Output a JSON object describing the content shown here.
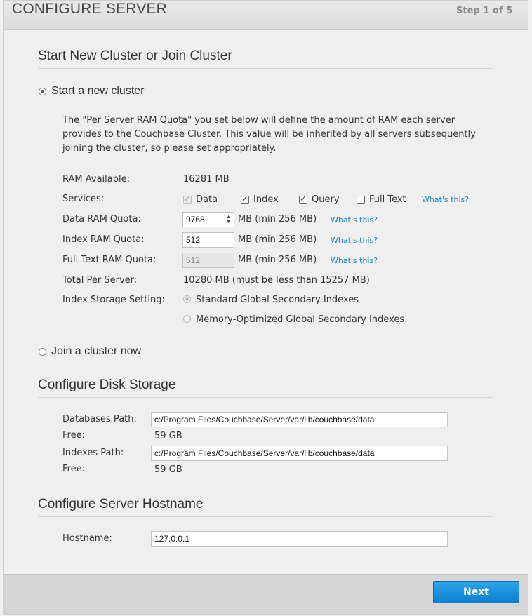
{
  "header": {
    "title": "CONFIGURE SERVER",
    "step": "Step 1 of 5"
  },
  "cluster": {
    "section_title": "Start New Cluster or Join Cluster",
    "start_new_label": "Start a new cluster",
    "join_label": "Join a cluster now",
    "description": "The \"Per Server RAM Quota\" you set below will define the amount of RAM each server provides to the Couchbase Cluster. This value will be inherited by all servers subsequently joining the cluster, so please set appropriately.",
    "ram_available_label": "RAM Available:",
    "ram_available_value": "16281 MB",
    "services_label": "Services:",
    "services": {
      "data": "Data",
      "index": "Index",
      "query": "Query",
      "full_text": "Full Text"
    },
    "whats_this": "What's this?",
    "data_ram_label": "Data RAM Quota:",
    "data_ram_value": "9768",
    "index_ram_label": "Index RAM Quota:",
    "index_ram_value": "512",
    "fulltext_ram_label": "Full Text RAM Quota:",
    "fulltext_ram_value": "512",
    "mb_min": "MB (min 256 MB)",
    "total_label": "Total Per Server:",
    "total_value": "10280 MB (must be less than 15257 MB)",
    "index_storage_label": "Index Storage Setting:",
    "standard_gsi": "Standard Global Secondary Indexes",
    "memopt_gsi": "Memory-Optimized Global Secondary Indexes"
  },
  "disk": {
    "section_title": "Configure Disk Storage",
    "db_path_label": "Databases Path:",
    "db_path_value": "c:/Program Files/Couchbase/Server/var/lib/couchbase/data",
    "free_label": "Free:",
    "db_free_value": "59 GB",
    "idx_path_label": "Indexes Path:",
    "idx_path_value": "c:/Program Files/Couchbase/Server/var/lib/couchbase/data",
    "idx_free_value": "59 GB"
  },
  "hostname": {
    "section_title": "Configure Server Hostname",
    "label": "Hostname:",
    "value": "127.0.0.1"
  },
  "footer": {
    "next_label": "Next"
  }
}
